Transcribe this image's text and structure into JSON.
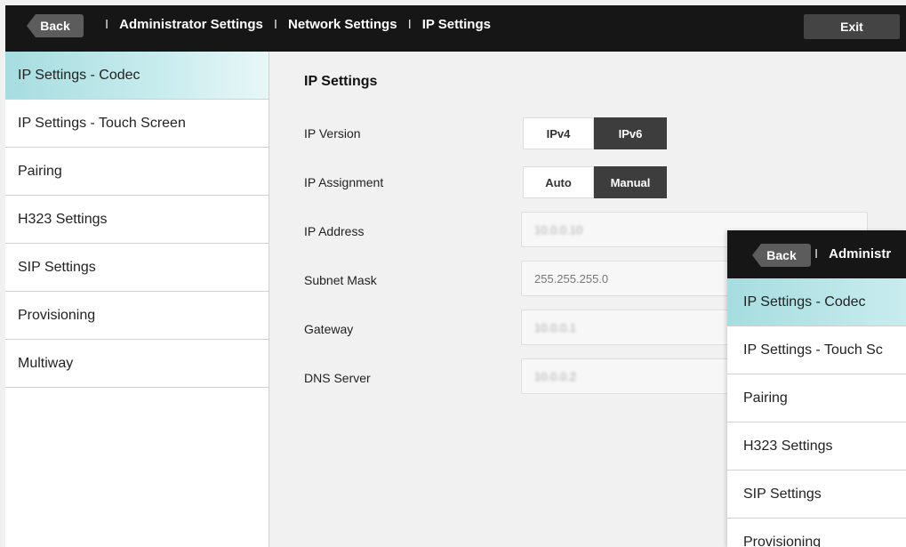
{
  "header": {
    "back_label": "Back",
    "breadcrumbs": [
      "Administrator Settings",
      "Network Settings",
      "IP Settings"
    ],
    "separator": "I",
    "exit_label": "Exit"
  },
  "sidebar": {
    "items": [
      {
        "label": "IP Settings - Codec",
        "active": true
      },
      {
        "label": "IP Settings - Touch Screen"
      },
      {
        "label": "Pairing"
      },
      {
        "label": "H323 Settings"
      },
      {
        "label": "SIP Settings"
      },
      {
        "label": "Provisioning"
      },
      {
        "label": "Multiway"
      }
    ]
  },
  "main": {
    "title": "IP Settings",
    "ip_version": {
      "label": "IP Version",
      "options": [
        "IPv4",
        "IPv6"
      ],
      "selected": "IPv6"
    },
    "ip_assignment": {
      "label": "IP Assignment",
      "options": [
        "Auto",
        "Manual"
      ],
      "selected": "Manual"
    },
    "ip_address": {
      "label": "IP Address",
      "value": "10.0.0.10"
    },
    "subnet_mask": {
      "label": "Subnet Mask",
      "value": "255.255.255.0"
    },
    "gateway": {
      "label": "Gateway",
      "value": "10.0.0.1"
    },
    "dns_server": {
      "label": "DNS Server",
      "value": "10.0.0.2"
    }
  },
  "overlay": {
    "back_label": "Back",
    "separator": "I",
    "crumb": "Administr",
    "items": [
      "IP Settings - Codec",
      "IP Settings - Touch Sc",
      "Pairing",
      "H323 Settings",
      "SIP Settings",
      "Provisioning"
    ]
  },
  "colors": {
    "accent": "#a6dde0",
    "topbar": "#161616",
    "selected": "#3d3d3d"
  }
}
